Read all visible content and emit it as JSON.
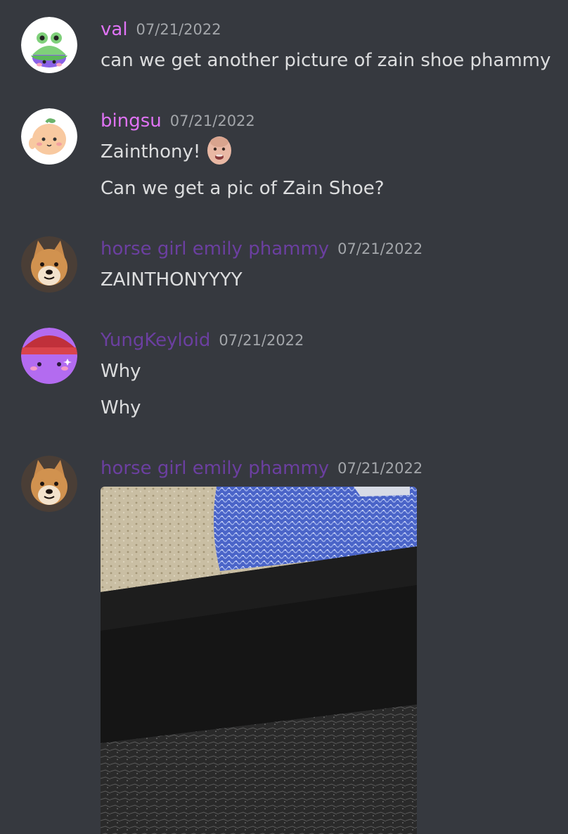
{
  "messages": [
    {
      "username": "val",
      "username_color": "#e073f5",
      "timestamp": "07/21/2022",
      "lines": [
        "can we get another picture of zain shoe phammy"
      ]
    },
    {
      "username": "bingsu",
      "username_color": "#e073f5",
      "timestamp": "07/21/2022",
      "lines": [
        "Zainthony!",
        "Can we get a pic of Zain Shoe?"
      ]
    },
    {
      "username": "horse girl emily phammy",
      "username_color": "#6b3fa0",
      "timestamp": "07/21/2022",
      "lines": [
        "ZAINTHONYYYY"
      ]
    },
    {
      "username": "YungKeyloid",
      "username_color": "#6b3fa0",
      "timestamp": "07/21/2022",
      "lines": [
        "Why",
        "Why"
      ]
    },
    {
      "username": "horse girl emily phammy",
      "username_color": "#6b3fa0",
      "timestamp": "07/21/2022",
      "attachment": "shoe-photo"
    }
  ],
  "icons": {
    "baby_emoji": "baby-face-emoji",
    "avatar_val": "frog-jelly-avatar",
    "avatar_bingsu": "peach-creature-avatar",
    "avatar_emily": "shiba-dog-avatar",
    "avatar_yung": "purple-beanie-avatar"
  }
}
